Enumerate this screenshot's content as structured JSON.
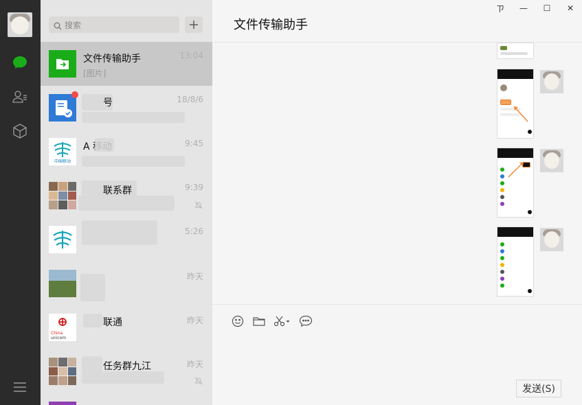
{
  "search": {
    "placeholder": "搜索"
  },
  "chat": {
    "title": "文件传输助手",
    "send_label": "发送(S)"
  },
  "window_controls": {
    "pin": "ㄗ",
    "minimize": "—",
    "maximize": "☐",
    "close": "✕"
  },
  "sessions": [
    {
      "name": "文件传输助手",
      "preview": "[图片]",
      "time": "13:04",
      "selected": true
    },
    {
      "name": "号",
      "preview": "",
      "time": "18/8/6",
      "unread": true
    },
    {
      "name": "A 移动",
      "preview": "",
      "time": "9:45"
    },
    {
      "name": "联系群",
      "preview": "",
      "time": "9:39",
      "muted": true
    },
    {
      "name": "",
      "preview": "",
      "time": "5:26"
    },
    {
      "name": "",
      "preview": "",
      "time": "昨天"
    },
    {
      "name": "联通",
      "preview": "",
      "time": "昨天"
    },
    {
      "name": "任务群九江",
      "preview": "",
      "time": "昨天",
      "muted": true
    }
  ],
  "icons": {
    "rail": [
      "chat-icon",
      "contacts-icon",
      "box-icon",
      "menu-icon"
    ],
    "toolbar": [
      "emoji-icon",
      "folder-icon",
      "scissors-icon",
      "chat-bubble-icon"
    ]
  },
  "colors": {
    "accent_green": "#1aad19",
    "rail_bg": "#2b2b2b",
    "list_bg": "#e6e5e5",
    "selected_bg": "#c9c8c8",
    "unread_dot": "#f44a4a"
  }
}
